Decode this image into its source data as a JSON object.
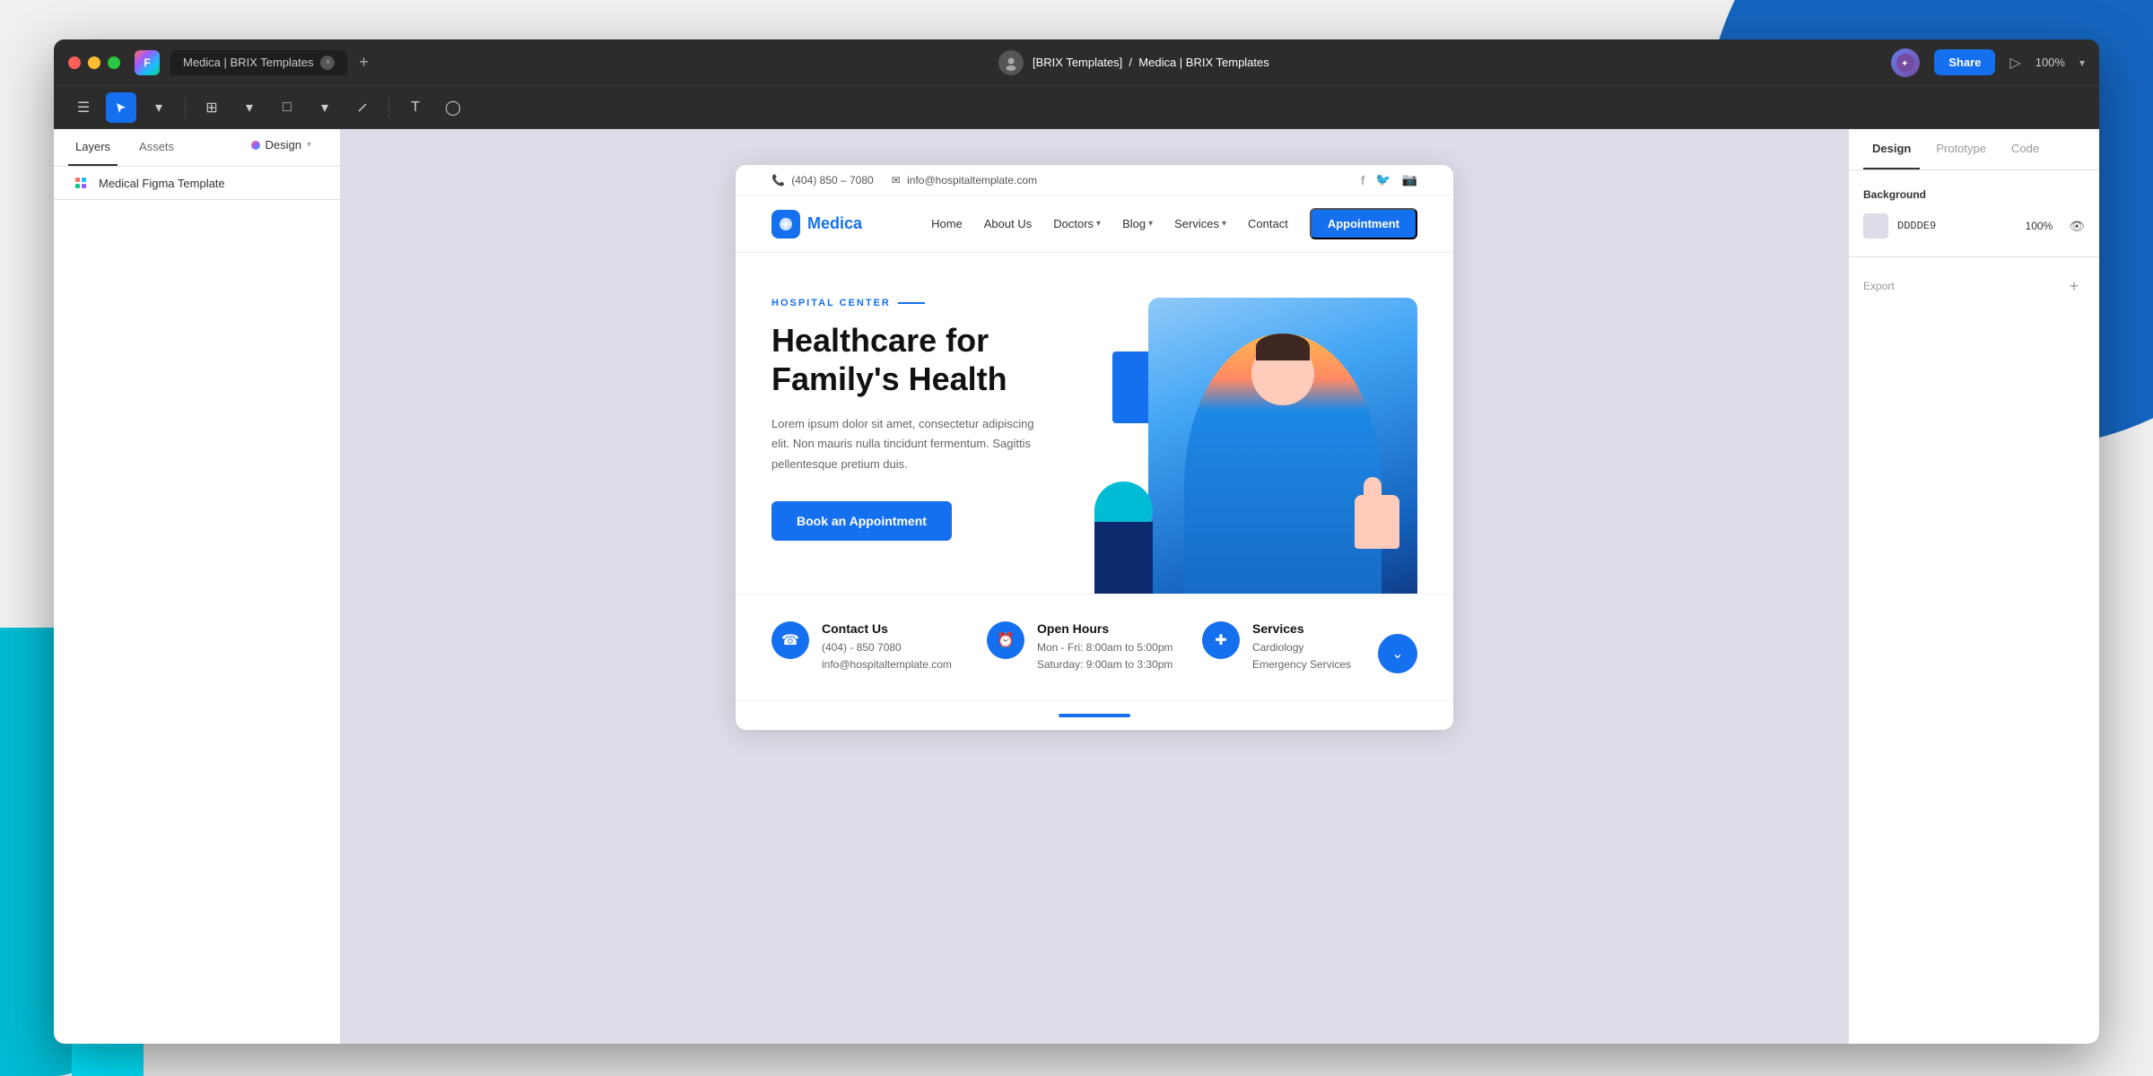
{
  "app": {
    "title": "Medica | BRIX Templates",
    "tab_label": "Medica | BRIX Templates",
    "tab_close": "×",
    "tab_add": "+",
    "zoom": "100%",
    "share_btn": "Share",
    "breadcrumb_user": "[BRIX Templates]",
    "breadcrumb_sep": "/",
    "breadcrumb_file": "Medica | BRIX Templates"
  },
  "toolbar": {
    "tools": [
      "☰",
      "▾",
      "⊞",
      "▾",
      "□",
      "▾",
      "⋏",
      "T",
      "◯"
    ]
  },
  "left_panel": {
    "tabs": [
      "Layers",
      "Assets"
    ],
    "design_tab": "Design",
    "layer_item": "Medical Figma Template"
  },
  "website": {
    "topbar": {
      "phone": "(404) 850 – 7080",
      "email": "info@hospitaltemplate.com"
    },
    "nav": {
      "logo": "Medica",
      "links": [
        "Home",
        "About Us",
        "Doctors",
        "Blog",
        "Services",
        "Contact"
      ],
      "appointment_btn": "Appointment"
    },
    "hero": {
      "label": "HOSPITAL CENTER",
      "title_line1": "Healthcare for",
      "title_line2": "Family's Health",
      "description": "Lorem ipsum dolor sit amet, consectetur adipiscing elit. Non mauris nulla tincidunt fermentum. Sagittis pellentesque pretium duis.",
      "cta_btn": "Book an Appointment"
    },
    "footer_cards": [
      {
        "icon": "☎",
        "title": "Contact Us",
        "line1": "(404) - 850 7080",
        "line2": "info@hospitaltemplate.com"
      },
      {
        "icon": "⏰",
        "title": "Open Hours",
        "line1": "Mon - Fri: 8:00am to 5:00pm",
        "line2": "Saturday: 9:00am to 3:30pm"
      },
      {
        "icon": "✚",
        "title": "Services",
        "line1": "Cardiology",
        "line2": "Emergency Services"
      }
    ]
  },
  "right_panel": {
    "tabs": [
      "Design",
      "Prototype",
      "Code"
    ],
    "background_section": {
      "title": "Background",
      "color_hex": "DDDDE9",
      "opacity": "100%"
    },
    "export_section": {
      "label": "Export",
      "add_icon": "+"
    }
  }
}
